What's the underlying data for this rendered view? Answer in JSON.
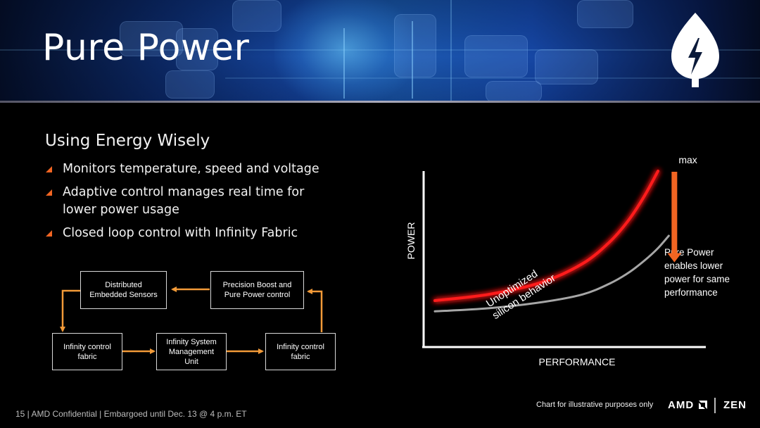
{
  "slide": {
    "title": "Pure Power",
    "subtitle": "Using Energy Wisely",
    "bullets": [
      "Monitors temperature, speed and voltage",
      "Adaptive control manages real time for lower power usage",
      "Closed loop control with Infinity Fabric"
    ],
    "icon": "leaf-lightning-icon",
    "accent_color": "#f26522",
    "arrow_color": "#f29a38"
  },
  "diagram": {
    "nodes": [
      {
        "id": "sensors",
        "lines": [
          "Distributed",
          "Embedded Sensors"
        ]
      },
      {
        "id": "precision",
        "lines": [
          "Precision Boost and",
          "Pure Power control"
        ]
      },
      {
        "id": "fabric_left",
        "lines": [
          "Infinity control",
          "fabric"
        ]
      },
      {
        "id": "smu",
        "lines": [
          "Infinity System",
          "Management",
          "Unit"
        ]
      },
      {
        "id": "fabric_right",
        "lines": [
          "Infinity control",
          "fabric"
        ]
      }
    ],
    "edges": [
      [
        "precision",
        "sensors"
      ],
      [
        "sensors",
        "fabric_left"
      ],
      [
        "fabric_left",
        "smu"
      ],
      [
        "smu",
        "fabric_right"
      ],
      [
        "fabric_right",
        "precision"
      ]
    ]
  },
  "chart_data": {
    "type": "line",
    "title": "",
    "xlabel": "PERFORMANCE",
    "ylabel": "POWER",
    "xlim": [
      0,
      100
    ],
    "ylim": [
      0,
      100
    ],
    "grid": false,
    "legend": "none",
    "series": [
      {
        "name": "Unoptimized silicon behavior",
        "color": "#ff1a1a",
        "glow": true,
        "x": [
          0,
          20,
          40,
          55,
          65,
          72,
          78,
          83
        ],
        "y": [
          16,
          20,
          28,
          40,
          54,
          68,
          84,
          100
        ]
      },
      {
        "name": "Pure Power",
        "color": "#a6a6a6",
        "glow": false,
        "x": [
          0,
          20,
          40,
          55,
          65,
          72,
          78,
          83,
          87
        ],
        "y": [
          9,
          11,
          15,
          20,
          27,
          34,
          42,
          50,
          58
        ]
      }
    ],
    "annotations": [
      {
        "text": "max",
        "x": 87,
        "y": 104
      },
      {
        "text": "Unoptimized silicon behavior",
        "x": 42,
        "y": 46,
        "rotation_deg": -33
      },
      {
        "text": "Pure Power enables lower power for same performance",
        "x": 90,
        "y": 52
      },
      {
        "type": "arrow",
        "from": [
          87,
          100
        ],
        "to": [
          87,
          60
        ],
        "color": "#f26522"
      }
    ]
  },
  "footer": {
    "text": "15 | AMD Confidential | Embargoed until Dec. 13 @ 4 p.m. ET",
    "chart_note": "Chart for illustrative purposes only",
    "brand_logo": "AMD",
    "product_logo": "ZEN"
  }
}
